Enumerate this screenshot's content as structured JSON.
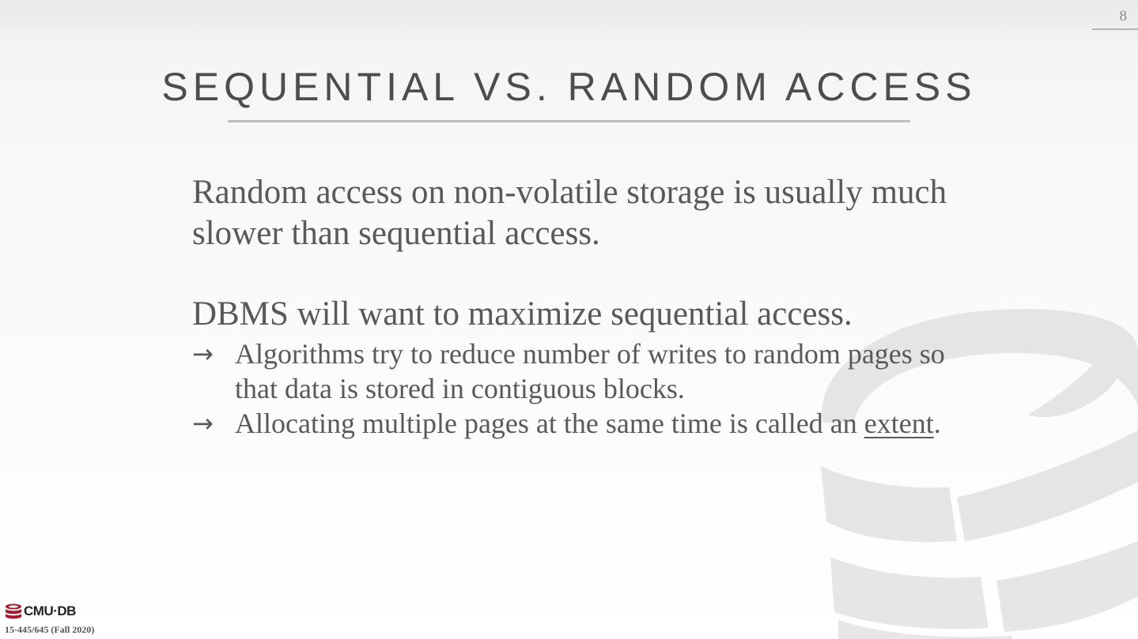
{
  "slide": {
    "number": "8",
    "title": "SEQUENTIAL VS. RANDOM ACCESS",
    "paragraph1": "Random access on non-volatile storage is usually much slower than sequential access.",
    "paragraph2": "DBMS will want to maximize sequential access.",
    "bullets": [
      {
        "text": "Algorithms try to reduce number of writes to random pages so that data is stored in contiguous blocks."
      },
      {
        "text_before": "Allocating multiple pages at the same time is called an",
        "term": "extent",
        "text_after": "."
      }
    ],
    "bullet_glyph": "→"
  },
  "footer": {
    "logo_text": "CMU·DB",
    "course": "15-445/645 (Fall 2020)"
  },
  "colors": {
    "text": "#595959",
    "title": "#4d4d4d",
    "logo_red": "#a6192e",
    "watermark": "#d9d9d9"
  },
  "icons": {
    "watermark": "database-cylinder-icon",
    "footer": "database-stack-icon"
  }
}
